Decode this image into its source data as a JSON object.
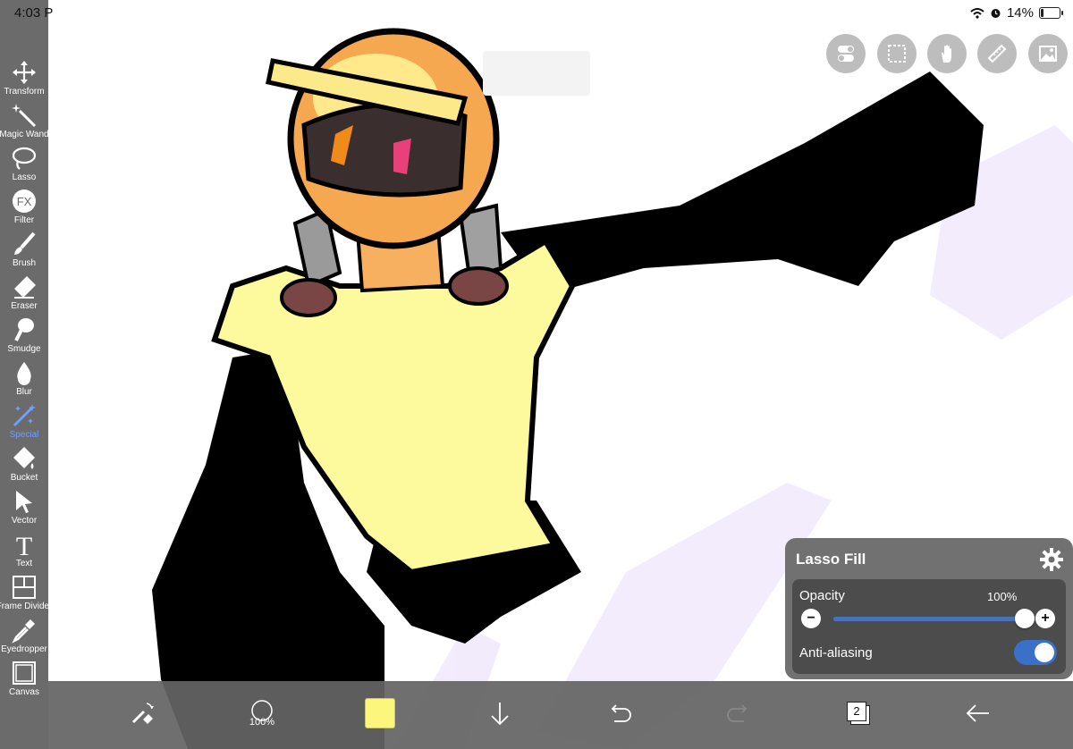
{
  "status_bar": {
    "time": "4:03 P",
    "battery_percent": "14%",
    "battery_level": 0.14
  },
  "toolbar": {
    "items": [
      {
        "label": "Transform",
        "icon": "move-arrows-icon"
      },
      {
        "label": "Magic Wand",
        "icon": "magic-wand-icon"
      },
      {
        "label": "Lasso",
        "icon": "lasso-icon"
      },
      {
        "label": "Filter",
        "icon": "fx-icon"
      },
      {
        "label": "Brush",
        "icon": "brush-icon"
      },
      {
        "label": "Eraser",
        "icon": "eraser-icon"
      },
      {
        "label": "Smudge",
        "icon": "smudge-icon"
      },
      {
        "label": "Blur",
        "icon": "droplet-icon"
      },
      {
        "label": "Special",
        "icon": "special-wand-icon",
        "active": true
      },
      {
        "label": "Bucket",
        "icon": "bucket-icon"
      },
      {
        "label": "Vector",
        "icon": "cursor-arrow-icon"
      },
      {
        "label": "Text",
        "icon": "text-t-icon"
      },
      {
        "label": "Frame Divider",
        "icon": "frame-divider-icon"
      },
      {
        "label": "Eyedropper",
        "icon": "eyedropper-icon"
      },
      {
        "label": "Canvas",
        "icon": "canvas-square-icon"
      }
    ]
  },
  "top_right_buttons": [
    "toggle-switch-icon",
    "selection-dashed-icon",
    "hand-gesture-icon",
    "ruler-icon",
    "image-icon"
  ],
  "bottom_bar": {
    "brush_size": "100%",
    "color": "#fcf77c",
    "layer_count": "2"
  },
  "lasso_fill_panel": {
    "title": "Lasso Fill",
    "opacity_label": "Opacity",
    "opacity_value": "100%",
    "opacity_level": 1.0,
    "minus": "−",
    "plus": "+",
    "anti_aliasing_label": "Anti-aliasing",
    "anti_aliasing_on": true
  },
  "colors": {
    "toolbar_bg": "#6b6b6b",
    "accent_blue": "#3a70c8",
    "shirt_yellow": "#fcfa9c",
    "helmet_orange": "#f5a850"
  }
}
